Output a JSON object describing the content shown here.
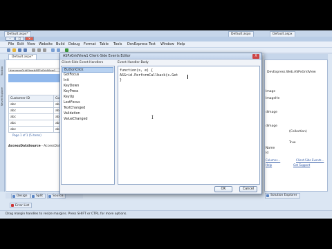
{
  "file_tabs": [
    "Default.aspx*",
    "Default.aspx",
    "Default.aspx"
  ],
  "menu": [
    "File",
    "Edit",
    "View",
    "Website",
    "Build",
    "Debug",
    "Format",
    "Table",
    "Tools",
    "DevExpress",
    "Test",
    "Window",
    "Help"
  ],
  "left_rail": [
    "Toolbox",
    "Server Explorer"
  ],
  "designer": {
    "tab": "Default.aspx*",
    "tag": "dxe:aspxGridView#ASPxGridView1",
    "columns": [
      "Customer ID",
      "Conta"
    ],
    "rows": [
      [
        "abc",
        "abc"
      ],
      [
        "abc",
        "abc"
      ],
      [
        "abc",
        "abc"
      ],
      [
        "abc",
        "abc"
      ],
      [
        "abc",
        "abc"
      ]
    ],
    "pager": "Page 1 of 1 (5 items)",
    "datasource_bold": "AccessDataSource",
    "datasource_rest": " - AccessDat"
  },
  "view_tabs": [
    "Design",
    "Split",
    "Source"
  ],
  "error_list": "Error List",
  "status_text": "Drag margin handles to resize margins. Press SHIFT or CTRL for more options.",
  "properties": {
    "header": "DevExpress.Web.ASPxGridView",
    "rows": [
      {
        "name": "Image",
        "value": ""
      },
      {
        "name": "ImageHe",
        "value": ""
      },
      {
        "name": "dImage",
        "value": ""
      },
      {
        "name": "dImage",
        "value": ""
      },
      {
        "name": "",
        "value": "(Collection)"
      },
      {
        "name": "",
        "value": "True"
      },
      {
        "name": "Name",
        "value": ""
      },
      {
        "name": "Id",
        "value": ""
      }
    ],
    "links": [
      "Columns...",
      "Client-Side Events...",
      "Help",
      "Get Support"
    ]
  },
  "solution_tab": "Solution Explorer",
  "dialog": {
    "title": "ASPxGridView1 Client-Side Events Editor",
    "close": "X",
    "events_label": "Client-Side Event Handlers",
    "body_label": "Event Handler Body",
    "events": [
      "ButtonClick",
      "GotFocus",
      "Init",
      "KeyDown",
      "KeyPress",
      "KeyUp",
      "LostFocus",
      "TextChanged",
      "Validation",
      "ValueChanged"
    ],
    "selected_index": 0,
    "code": [
      "function(s, e) {",
      "    ASGrid.PerformCallback(s.Get",
      "}"
    ],
    "ok": "OK",
    "cancel": "Cancel"
  },
  "colors": {
    "accent": "#90b8ec",
    "selection": "#b8d2f1",
    "chrome": "#dbe6f3"
  }
}
